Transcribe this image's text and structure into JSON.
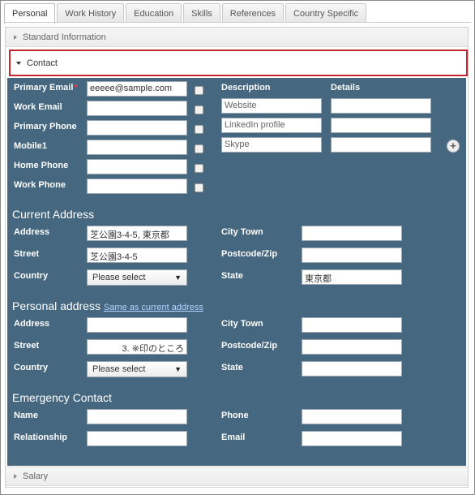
{
  "tabs": [
    "Personal",
    "Work History",
    "Education",
    "Skills",
    "References",
    "Country Specific"
  ],
  "sections": {
    "standard": "Standard Information",
    "contact": "Contact",
    "salary": "Salary"
  },
  "contact": {
    "labels": {
      "primary_email": "Primary Email",
      "work_email": "Work Email",
      "primary_phone": "Primary Phone",
      "mobile1": "Mobile1",
      "home_phone": "Home Phone",
      "work_phone": "Work Phone"
    },
    "required_mark": "*",
    "primary_email_value": "eeeee@sample.com",
    "description_header": "Description",
    "details_header": "Details",
    "descriptions": [
      "Website",
      "LinkedIn profile",
      "Skype"
    ],
    "add_icon": "plus-circle-icon"
  },
  "current_address": {
    "title": "Current Address",
    "labels": {
      "address": "Address",
      "street": "Street",
      "country": "Country",
      "city": "City Town",
      "postcode": "Postcode/Zip",
      "state": "State"
    },
    "address_value": "芝公園3-4-5, 東京都",
    "street_value": "芝公園3-4-5",
    "country_value": "Please select",
    "state_value": "東京都"
  },
  "personal_address": {
    "title": "Personal address",
    "same_link": "Same as current address",
    "labels": {
      "address": "Address",
      "street": "Street",
      "country": "Country",
      "city": "City Town",
      "postcode": "Postcode/Zip",
      "state": "State"
    },
    "street_value": "3. ※印のところ",
    "country_value": "Please select"
  },
  "emergency": {
    "title": "Emergency Contact",
    "labels": {
      "name": "Name",
      "relationship": "Relationship",
      "phone": "Phone",
      "email": "Email"
    }
  },
  "colors": {
    "panel": "#45677f",
    "highlight": "#c0262b"
  }
}
